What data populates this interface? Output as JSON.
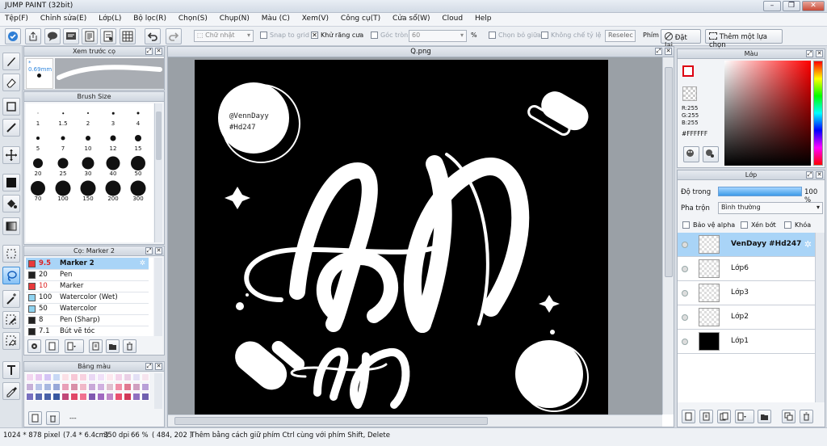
{
  "window": {
    "title": "JUMP PAINT (32bit)",
    "min": "–",
    "max": "❐",
    "close": "✕"
  },
  "menu": [
    "Tệp(F)",
    "Chỉnh sửa(E)",
    "Lớp(L)",
    "Bộ lọc(R)",
    "Chọn(S)",
    "Chụp(N)",
    "Màu (C)",
    "Xem(V)",
    "Công cụ(T)",
    "Cửa sổ(W)",
    "Cloud",
    "Help"
  ],
  "toolbar": {
    "shape_select": "Chữ nhật",
    "snap_to_grid": "Snap to grid",
    "anti_alias": "Khử răng cưa",
    "corner_round": "Góc tròn",
    "corner_value": "60",
    "percent": "%",
    "select_center": "Chọn bỏ giữa",
    "lock_ratio": "Không chế tỷ lệ",
    "reselect": "Reselec",
    "key_label": "Phím",
    "reset_btn": "Đặt lại",
    "add_selection_btn": "Thêm một lựa chọn"
  },
  "brush_preview": {
    "title": "Xem trước cọ",
    "size": "* 0.69mm"
  },
  "brush_size": {
    "title": "Brush Size",
    "sizes": [
      "1",
      "1.5",
      "2",
      "3",
      "4",
      "5",
      "7",
      "10",
      "12",
      "15",
      "20",
      "25",
      "30",
      "40",
      "50",
      "70",
      "100",
      "150",
      "200",
      "300"
    ]
  },
  "brush_list": {
    "title": "Cọ: Marker 2",
    "items": [
      {
        "size": "9.5",
        "name": "Marker 2",
        "color": "#e8393b",
        "selected": true
      },
      {
        "size": "20",
        "name": "Pen",
        "color": "#222222",
        "selected": false
      },
      {
        "size": "10",
        "name": "Marker",
        "color": "#e8393b",
        "selected": false
      },
      {
        "size": "100",
        "name": "Watercolor (Wet)",
        "color": "#8fd3f0",
        "selected": false
      },
      {
        "size": "50",
        "name": "Watercolor",
        "color": "#8fd3f0",
        "selected": false
      },
      {
        "size": "8",
        "name": "Pen (Sharp)",
        "color": "#222222",
        "selected": false
      },
      {
        "size": "7.1",
        "name": "Bút vẽ tóc",
        "color": "#222222",
        "selected": false
      }
    ]
  },
  "palette": {
    "title": "Bảng màu",
    "extra": "---"
  },
  "canvas": {
    "tab": "Q.png",
    "watermark_line1": "@VennDayy",
    "watermark_line2": "#Hd247"
  },
  "color_panel": {
    "title": "Màu",
    "r": "R:255",
    "g": "G:255",
    "b": "B:255",
    "hex": "#FFFFFF",
    "hue_color": "#ff0000"
  },
  "layers": {
    "title": "Lớp",
    "opacity_label": "Độ trong",
    "opacity_value": "100 %",
    "opacity_fraction": 1.0,
    "blend_label": "Pha trộn",
    "blend_value": "Bình thường",
    "protect_alpha": "Bảo vệ alpha",
    "clip": "Xén bớt",
    "lock": "Khóa",
    "items": [
      {
        "name": "VenDayy #Hd247",
        "selected": true,
        "black_thumb": false
      },
      {
        "name": "Lớp6",
        "selected": false,
        "black_thumb": false
      },
      {
        "name": "Lớp3",
        "selected": false,
        "black_thumb": false
      },
      {
        "name": "Lớp2",
        "selected": false,
        "black_thumb": false
      },
      {
        "name": "Lớp1",
        "selected": false,
        "black_thumb": true
      }
    ]
  },
  "status": {
    "dims": "1024 * 878 pixel",
    "phys": "(7.4 * 6.4cm)",
    "dpi": "350 dpi",
    "zoom": "66 %",
    "coords": "( 484, 202 )",
    "hint": "Thêm bằng cách giữ phím Ctrl cùng với phím Shift, Delete"
  }
}
